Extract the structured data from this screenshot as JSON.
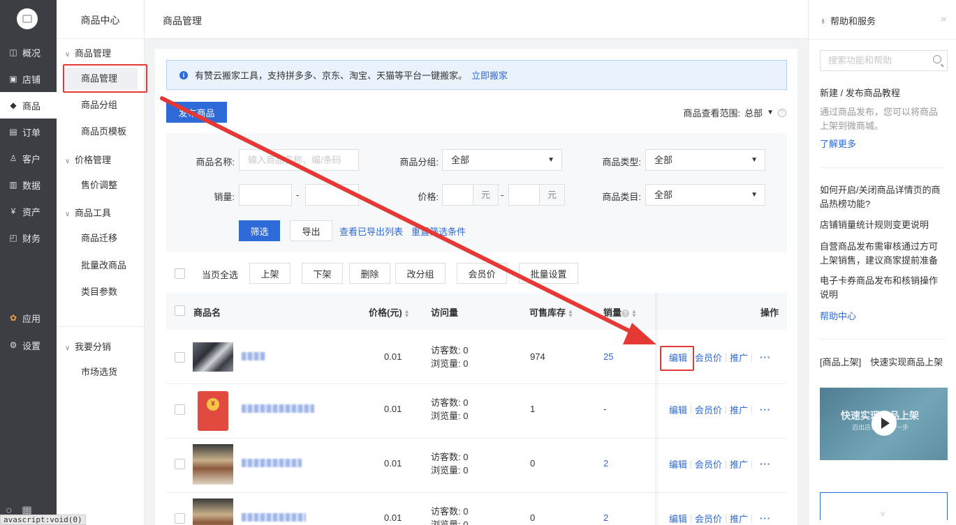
{
  "nav": {
    "items": [
      {
        "icon": "overview-icon",
        "glyph": "◫",
        "label": "概况"
      },
      {
        "icon": "store-icon",
        "glyph": "▣",
        "label": "店铺"
      },
      {
        "icon": "tag-icon",
        "glyph": "◆",
        "label": "商品"
      },
      {
        "icon": "order-icon",
        "glyph": "▤",
        "label": "订单"
      },
      {
        "icon": "customer-icon",
        "glyph": "♙",
        "label": "客户"
      },
      {
        "icon": "data-icon",
        "glyph": "▥",
        "label": "数据"
      },
      {
        "icon": "asset-icon",
        "glyph": "¥",
        "label": "资产"
      },
      {
        "icon": "finance-icon",
        "glyph": "◰",
        "label": "财务"
      },
      {
        "icon": "apps-icon",
        "glyph": "✿",
        "label": "应用"
      },
      {
        "icon": "settings-icon",
        "glyph": "⚙",
        "label": "设置"
      }
    ]
  },
  "subnav": {
    "title": "商品中心",
    "group1": "商品管理",
    "item1": "商品管理",
    "item2": "商品分组",
    "item3": "商品页模板",
    "group2": "价格管理",
    "item4": "售价调整",
    "group3": "商品工具",
    "item5": "商品迁移",
    "item6": "批量改商品",
    "item7": "类目参数",
    "group4": "我要分销",
    "item8": "市场选货"
  },
  "topbar": {
    "title": "商品管理"
  },
  "notice": {
    "text": "有赞云搬家工具，支持拼多多、京东、淘宝、天猫等平台一键搬家。",
    "link": "立即搬家"
  },
  "publish_button": "发布商品",
  "scope": {
    "label": "商品查看范围:",
    "value": "总部"
  },
  "filter": {
    "name_label": "商品名称:",
    "name_placeholder": "输入商品名称、编/条码",
    "group_label": "商品分组:",
    "group_value": "全部",
    "type_label": "商品类型:",
    "type_value": "全部",
    "sales_label": "销量:",
    "price_label": "价格:",
    "unit": "元",
    "category_label": "商品类目:",
    "category_value": "全部",
    "dash": "-",
    "filter_button": "筛选",
    "export_button": "导出",
    "view_exported": "查看已导出列表",
    "reset": "重置筛选条件"
  },
  "bulk": {
    "select_all": "当页全选",
    "shelf_up": "上架",
    "shelf_down": "下架",
    "delete": "删除",
    "change_group": "改分组",
    "member_price": "会员价",
    "batch_settings": "批量设置"
  },
  "table": {
    "col_name": "商品名",
    "col_price": "价格(元)",
    "col_visits": "访问量",
    "col_stock": "可售库存",
    "col_sales": "销量",
    "col_ops": "操作",
    "visitors_prefix": "访客数:",
    "views_prefix": "浏览量:",
    "op_edit": "编辑",
    "op_member": "会员价",
    "op_promote": "推广",
    "op_more": "···",
    "rows": [
      {
        "thumb": "photo-thumbnail",
        "price": "0.01",
        "visitors": "0",
        "views": "0",
        "stock": "974",
        "sales": "25"
      },
      {
        "thumb": "red-envelope-thumbnail",
        "price": "0.01",
        "visitors": "0",
        "views": "0",
        "stock": "1",
        "sales": "-"
      },
      {
        "thumb": "photo-thumbnail",
        "price": "0.01",
        "visitors": "0",
        "views": "0",
        "stock": "0",
        "sales": "2"
      },
      {
        "thumb": "photo-thumbnail",
        "price": "0.01",
        "visitors": "0",
        "views": "0",
        "stock": "0",
        "sales": "2"
      }
    ]
  },
  "help": {
    "title": "帮助和服务",
    "search_placeholder": "搜索功能和帮助",
    "tutorial_title": "新建 / 发布商品教程",
    "tutorial_desc": "通过商品发布，您可以将商品上架到微商城。",
    "learn_more": "了解更多",
    "q1": "如何开启/关闭商品详情页的商品热榜功能?",
    "q2": "店铺销量统计规则变更说明",
    "q3": "自营商品发布需审核通过方可上架销售，建议商家提前准备",
    "q4": "电子卡券商品发布和核销操作说明",
    "help_center": "帮助中心",
    "video_caption": "[商品上架]　快速实现商品上架",
    "video_title": "快速实现商品上架",
    "video_sub": "迈出店铺经营第一步"
  },
  "statusbar": "avascript:void(0)",
  "colors": {
    "primary": "#2f6ad9",
    "nav_bg": "#3c3e43",
    "annotation_red": "#e53935"
  }
}
